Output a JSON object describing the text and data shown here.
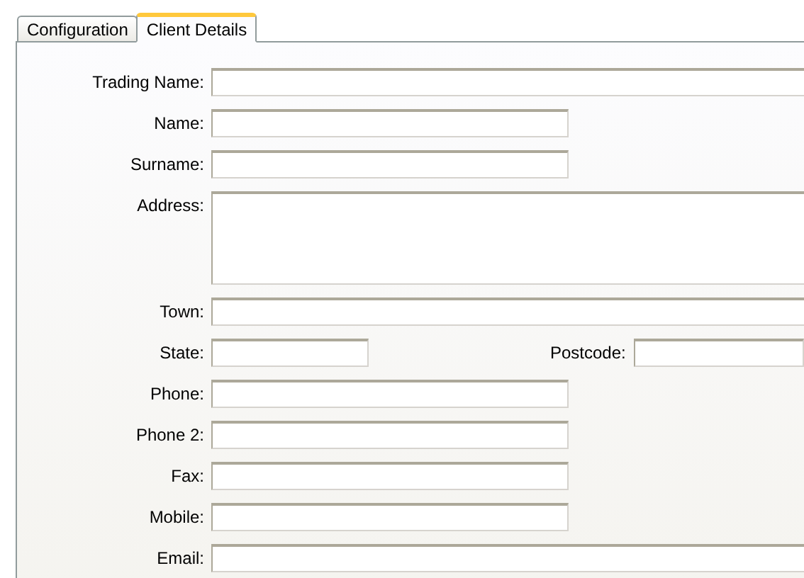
{
  "tabs": [
    {
      "label": "Configuration",
      "selected": false
    },
    {
      "label": "Client Details",
      "selected": true
    }
  ],
  "fields": [
    {
      "label": "Trading Name:",
      "kind": "wide"
    },
    {
      "label": "Name:",
      "kind": "medium"
    },
    {
      "label": "Surname:",
      "kind": "medium"
    },
    {
      "label": "Address:",
      "kind": "multiline"
    },
    {
      "label": "Town:",
      "kind": "wide"
    },
    {
      "label": "State:",
      "kind": "short",
      "second": {
        "label": "Postcode:"
      }
    },
    {
      "label": "Phone:",
      "kind": "medium"
    },
    {
      "label": "Phone 2:",
      "kind": "medium"
    },
    {
      "label": "Fax:",
      "kind": "medium"
    },
    {
      "label": "Mobile:",
      "kind": "medium"
    },
    {
      "label": "Email:",
      "kind": "wide"
    }
  ]
}
